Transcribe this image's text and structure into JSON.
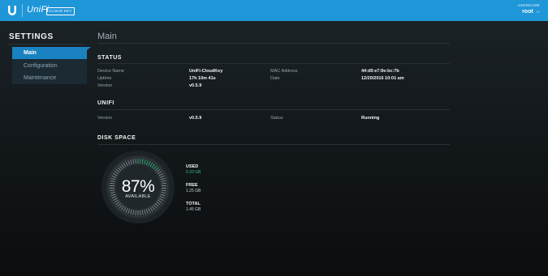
{
  "topbar": {
    "brand": "UniFi",
    "badge": "CLOUD KEY",
    "user_label": "USERNAME",
    "user_name": "root",
    "user_chevron": "⌵"
  },
  "sidebar": {
    "title": "SETTINGS",
    "items": [
      {
        "label": "Main",
        "active": true
      },
      {
        "label": "Configuration",
        "active": false
      },
      {
        "label": "Maintenance",
        "active": false
      }
    ]
  },
  "main": {
    "page_title": "Main",
    "status": {
      "title": "STATUS",
      "device_name_label": "Device Name",
      "device_name_value": "UniFi-CloudKey",
      "uptime_label": "Uptime",
      "uptime_value": "17h 10m 41s",
      "version_label": "Version",
      "version_value": "v0.5.9",
      "mac_label": "MAC Address",
      "mac_value": "44:d9:e7:9e:bc:7b",
      "date_label": "Date",
      "date_value": "12/20/2016 10:01 am"
    },
    "unifi": {
      "title": "UNIFI",
      "version_label": "Version",
      "version_value": "v0.5.9",
      "status_label": "Status",
      "status_value": "Running"
    },
    "disk": {
      "title": "DISK SPACE",
      "percent_text": "87%",
      "available_label": "AVAILABLE",
      "used_fraction": 0.13,
      "used_label": "USED",
      "used_value": "0.20 GB",
      "free_label": "FREE",
      "free_value": "1.25 GB",
      "total_label": "TOTAL",
      "total_value": "1.45 GB"
    }
  },
  "colors": {
    "topbar": "#1f96d8",
    "active_nav": "#1a82c0",
    "used": "#36c27f"
  }
}
